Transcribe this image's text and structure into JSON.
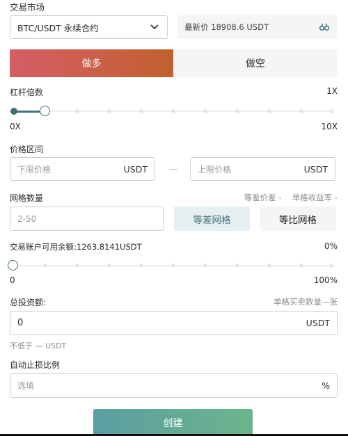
{
  "market": {
    "label": "交易市场",
    "select_value": "BTC/USDT 永续合约",
    "price_label": "最新价",
    "price_value": "18908.6 USDT",
    "icon": "binoculars-icon"
  },
  "side": {
    "long_label": "做多",
    "short_label": "做空",
    "long_color_start": "#d45e66",
    "long_color_end": "#c2612e"
  },
  "leverage": {
    "label": "杠杆倍数",
    "value": "1X",
    "min": "0X",
    "max": "10X",
    "level": 0.1
  },
  "price_range": {
    "label": "价格区间",
    "lower_placeholder": "下限价格",
    "upper_placeholder": "上限价格",
    "unit": "USDT",
    "separator": "—"
  },
  "grid": {
    "label": "网格数量",
    "diff_label": "等差价差 -",
    "yield_label": "单格收益率 -",
    "placeholder": "2-50",
    "arithmetic_label": "等差网格",
    "geometric_label": "等比网格"
  },
  "account": {
    "label": "交易账户可用余额:1263.8141USDT",
    "percent": "0%",
    "min": "0",
    "max": "100%",
    "level": 0
  },
  "investment": {
    "label": "总投资额:",
    "hint": "单格买卖数量—张",
    "value": "0",
    "unit": "USDT",
    "minimum": "不低于 — USDT"
  },
  "stop_loss": {
    "label": "自动止损比例",
    "placeholder": "选填",
    "unit": "%"
  },
  "create_button": "创建",
  "colors": {
    "accent_teal": "#3f6f77",
    "arithmetic_bg": "#e6eff1",
    "create_start": "#5b9ea3",
    "create_end": "#6cb58b"
  }
}
